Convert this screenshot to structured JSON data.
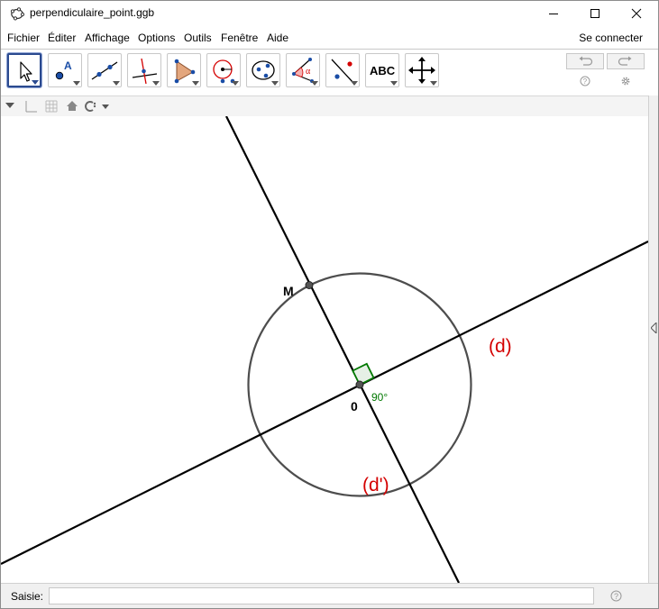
{
  "window": {
    "title": "perpendiculaire_point.ggb"
  },
  "menu": {
    "items": [
      "Fichier",
      "Éditer",
      "Affichage",
      "Options",
      "Outils",
      "Fenêtre",
      "Aide"
    ],
    "connect_label": "Se connecter"
  },
  "toolbar": {
    "tools": [
      {
        "name": "move-tool",
        "icon": "arrow-pointer-icon"
      },
      {
        "name": "point-tool",
        "icon": "point-icon",
        "label": "A"
      },
      {
        "name": "line-tool",
        "icon": "line-through-points-icon"
      },
      {
        "name": "perpendicular-tool",
        "icon": "perpendicular-line-icon"
      },
      {
        "name": "polygon-tool",
        "icon": "polygon-icon"
      },
      {
        "name": "circle-tool",
        "icon": "circle-center-point-icon"
      },
      {
        "name": "conic-tool",
        "icon": "ellipse-icon"
      },
      {
        "name": "angle-tool",
        "icon": "angle-icon",
        "label": "α"
      },
      {
        "name": "reflect-tool",
        "icon": "reflect-line-icon"
      },
      {
        "name": "text-tool",
        "icon": "text-icon",
        "label": "ABC"
      },
      {
        "name": "move-graphics-tool",
        "icon": "move-graphics-icon"
      }
    ]
  },
  "construction": {
    "point_M": "M",
    "point_O": "0",
    "line_d": "(d)",
    "line_d_prime": "(d')",
    "angle_label": "90°"
  },
  "colors": {
    "accent": "#2b4a8f",
    "label_red": "#d40000",
    "angle_green": "#007800",
    "angle_fill": "#e6f0e6",
    "circle": "#4d4d4d",
    "line": "#000000"
  },
  "input": {
    "label": "Saisie:",
    "value": ""
  }
}
